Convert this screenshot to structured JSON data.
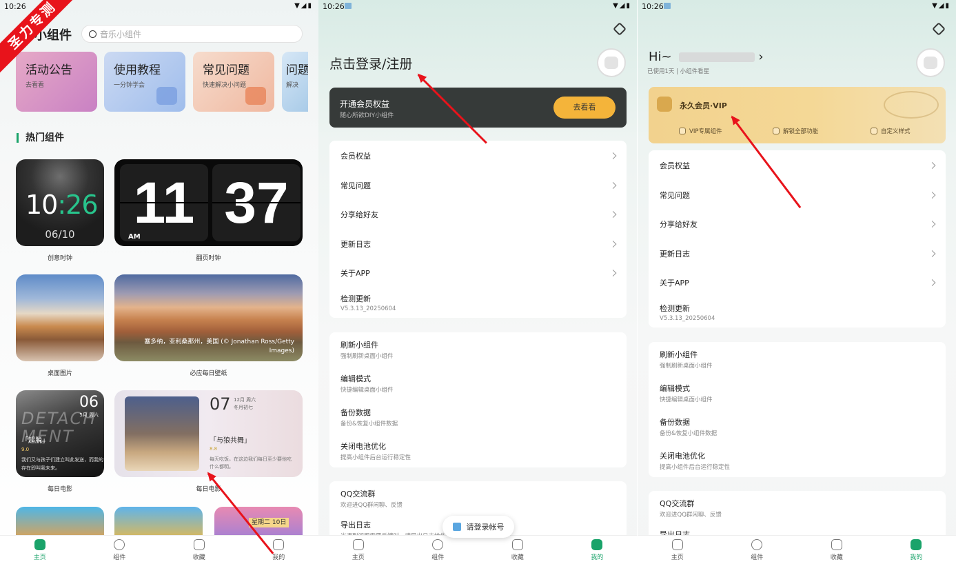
{
  "watermark": "圣力专测",
  "status": {
    "time": "10:26",
    "icons": "▼◢▮"
  },
  "nav": [
    "主页",
    "组件",
    "收藏",
    "我的"
  ],
  "panel1": {
    "title": "小组件",
    "search_placeholder": "音乐小组件",
    "cards": [
      {
        "title": "活动公告",
        "sub": "去看看",
        "color": "#d37fc0"
      },
      {
        "title": "使用教程",
        "sub": "一分钟学会",
        "color": "#a7c1ea"
      },
      {
        "title": "常见问题",
        "sub": "快速解决小问题",
        "color": "#f2c1aa"
      },
      {
        "title": "问题",
        "sub": "解决",
        "color": "#a9cbe8"
      }
    ],
    "hot_title": "热门组件",
    "clock_creative": {
      "hour": "10",
      "sep": ":",
      "min": "26",
      "date": "06/10",
      "label": "创意时钟"
    },
    "clock_flip": {
      "hour": "11",
      "min": "37",
      "ampm": "AM",
      "label": "翻页时钟"
    },
    "photo_desk": {
      "label": "桌面图片"
    },
    "photo_daily": {
      "caption": "塞多纳，亚利桑那州，美国 (© Jonathan Ross/Getty Images)",
      "label": "必应每日壁纸"
    },
    "movie_a": {
      "day": "06",
      "month": "5月 周六",
      "watermark": "DETACH MENT",
      "title": "「超脱」",
      "score": "9.0",
      "quote": "我们又与孩子们建立叫此发送，而我的存在即叫我未来。",
      "label": "每日电影"
    },
    "movie_b": {
      "day": "07",
      "meta": "12月 周六\n冬月初七",
      "title": "「与狼共舞」",
      "score": "8.8",
      "quote": "每天吃饭，在这边我们每日至少要他吃什么都明。",
      "label": "每日电影"
    },
    "mini_date": "星期二 10日"
  },
  "panel2": {
    "login_title": "点击登录/注册",
    "vip_title": "开通会员权益",
    "vip_sub": "随心所欲DIY小组件",
    "vip_button": "去看看",
    "group1": [
      {
        "title": "会员权益",
        "chev": true
      },
      {
        "title": "常见问题",
        "chev": true
      },
      {
        "title": "分享给好友",
        "chev": true
      },
      {
        "title": "更新日志",
        "chev": true
      },
      {
        "title": "关于APP",
        "chev": true
      },
      {
        "title": "检测更新",
        "sub": "V5.3.13_20250604"
      }
    ],
    "group2": [
      {
        "title": "刷新小组件",
        "sub": "强制刷新桌面小组件"
      },
      {
        "title": "编辑模式",
        "sub": "快捷编辑桌面小组件"
      },
      {
        "title": "备份数据",
        "sub": "备份&恢复小组件数据"
      },
      {
        "title": "关闭电池优化",
        "sub": "提高小组件后台运行稳定性"
      }
    ],
    "group3": [
      {
        "title": "QQ交流群",
        "sub": "欢迎进QQ群闲聊、反馈"
      },
      {
        "title": "导出日志",
        "sub": "当遇到问题需要反馈时，请导出日志给作者"
      }
    ],
    "toast": "请登录帐号"
  },
  "panel3": {
    "hi": "Hi~",
    "hi_sub": "已使用1天 | 小组件看星",
    "vip_title": "永久会员·VIP",
    "vip_features": [
      "VIP专属组件",
      "解锁全部功能",
      "自定义样式"
    ],
    "group1": [
      {
        "title": "会员权益",
        "chev": true
      },
      {
        "title": "常见问题",
        "chev": true
      },
      {
        "title": "分享给好友",
        "chev": true
      },
      {
        "title": "更新日志",
        "chev": true
      },
      {
        "title": "关于APP",
        "chev": true
      },
      {
        "title": "检测更新",
        "sub": "V5.3.13_20250604"
      }
    ],
    "group2": [
      {
        "title": "刷新小组件",
        "sub": "强制刷新桌面小组件"
      },
      {
        "title": "编辑模式",
        "sub": "快捷编辑桌面小组件"
      },
      {
        "title": "备份数据",
        "sub": "备份&恢复小组件数据"
      },
      {
        "title": "关闭电池优化",
        "sub": "提高小组件后台运行稳定性"
      }
    ],
    "group3": [
      {
        "title": "QQ交流群",
        "sub": "欢迎进QQ群闲聊、反馈"
      },
      {
        "title": "导出日志",
        "sub": ""
      }
    ]
  },
  "colors": {
    "accent": "#1aa36a",
    "arrow": "#e8131b",
    "vip_button": "#f4b43a",
    "vip_gold": "#f2d28e"
  }
}
